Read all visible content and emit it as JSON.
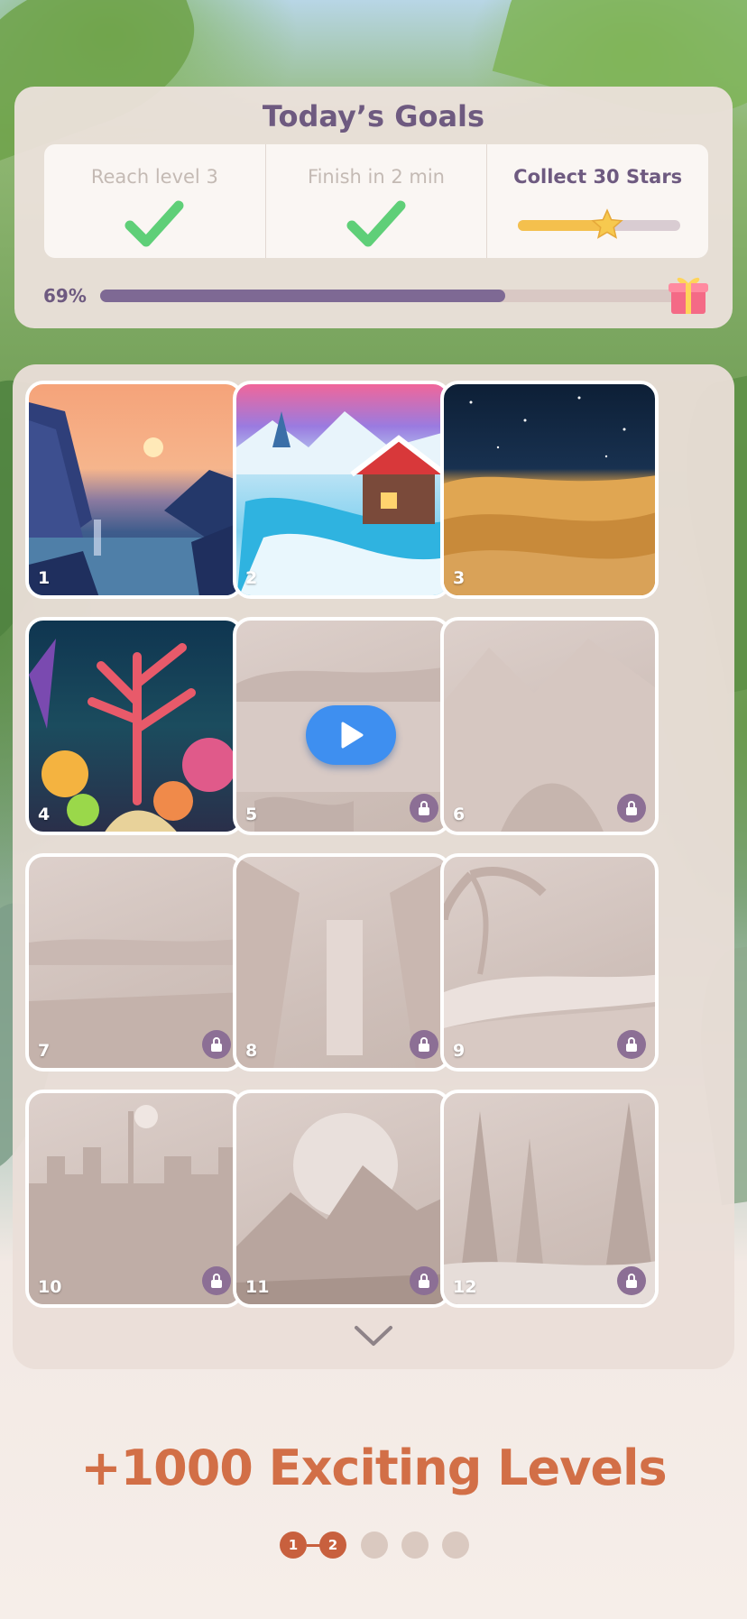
{
  "goals": {
    "title": "Today’s Goals",
    "items": [
      {
        "label": "Reach level 3",
        "status": "done"
      },
      {
        "label": "Finish in 2 min",
        "status": "done"
      },
      {
        "label": "Collect 30 Stars",
        "status": "in-progress",
        "progress": 0.55
      }
    ],
    "overall_progress_label": "69%",
    "overall_progress": 0.69,
    "reward_icon": "gift-icon"
  },
  "levels": [
    {
      "number": "1",
      "state": "unlocked",
      "scene": "sunset-canyon-lake"
    },
    {
      "number": "2",
      "state": "unlocked",
      "scene": "snowy-village"
    },
    {
      "number": "3",
      "state": "unlocked",
      "scene": "desert-night"
    },
    {
      "number": "4",
      "state": "unlocked",
      "scene": "coral-reef"
    },
    {
      "number": "5",
      "state": "locked",
      "action": "play-ad",
      "scene": "misty-lake"
    },
    {
      "number": "6",
      "state": "locked",
      "scene": "mountain-valley"
    },
    {
      "number": "7",
      "state": "locked",
      "scene": "wheat-field"
    },
    {
      "number": "8",
      "state": "locked",
      "scene": "jungle-waterfall"
    },
    {
      "number": "9",
      "state": "locked",
      "scene": "palm-beach"
    },
    {
      "number": "10",
      "state": "locked",
      "scene": "city-moon"
    },
    {
      "number": "11",
      "state": "locked",
      "scene": "mountain-moon"
    },
    {
      "number": "12",
      "state": "locked",
      "scene": "snowy-forest"
    }
  ],
  "headline": "+1000 Exciting Levels",
  "pager": {
    "pages": [
      "1",
      "2"
    ],
    "total_dots": 5,
    "active_through": 2
  },
  "colors": {
    "accent": "#d26f47",
    "goal_purple": "#6e5a80",
    "check_green": "#5fcf78",
    "star_yellow": "#f4c04d",
    "play_blue": "#3e8ff0",
    "lock_purple": "#8c6f95"
  }
}
